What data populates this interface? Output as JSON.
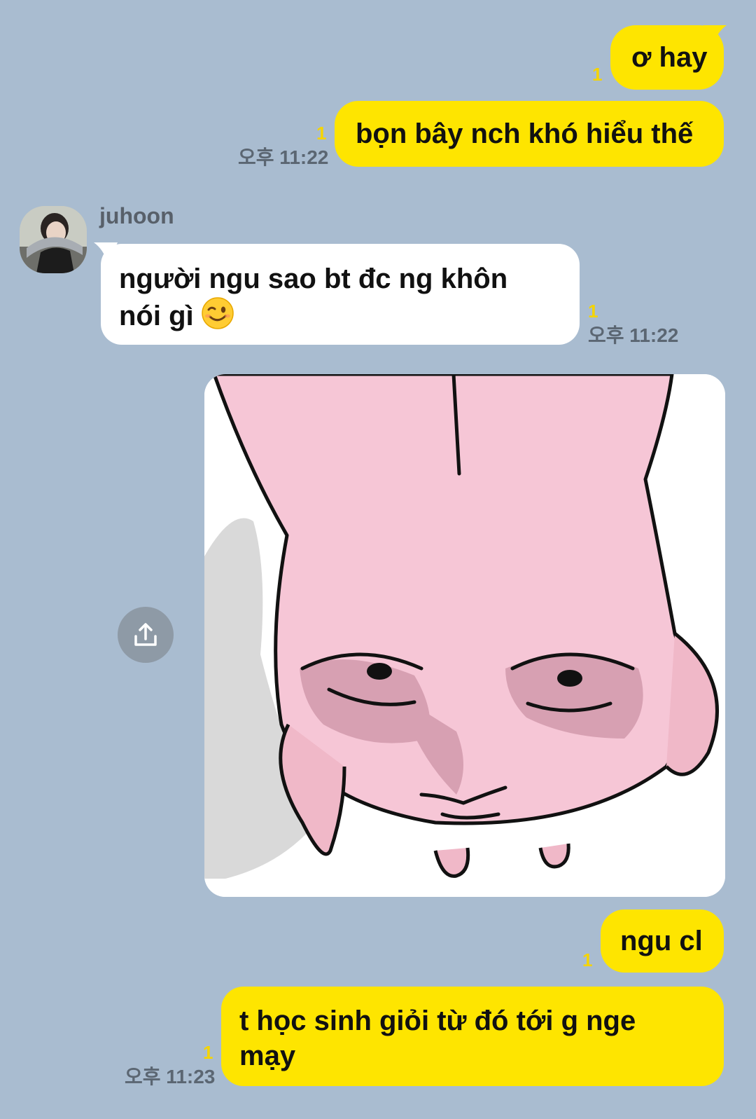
{
  "chat": {
    "messages": [
      {
        "text": "ơ hay",
        "unread": "1"
      },
      {
        "text": "bọn bây nch khó hiểu thế",
        "unread": "1",
        "time": "오후 11:22"
      },
      {
        "sender": "juhoon",
        "line1": "người ngu sao bt đc ng khôn",
        "line2": "nói gì",
        "emoji": "winking-face",
        "unread": "1",
        "time": "오후 11:22"
      },
      {
        "type": "sticker",
        "sticker": "pink-rabbit-sleepy-face"
      },
      {
        "text": "ngu cl",
        "unread": "1"
      },
      {
        "line1": "t học sinh giỏi từ đó tới g nge",
        "line2": "mạy",
        "unread": "1",
        "time": "오후 11:23"
      }
    ]
  },
  "colors": {
    "background": "#A9BCD0",
    "my_bubble": "#FEE500",
    "their_bubble": "#FFFFFF",
    "unread": "#F5D400",
    "timestamp": "#5B6672"
  }
}
